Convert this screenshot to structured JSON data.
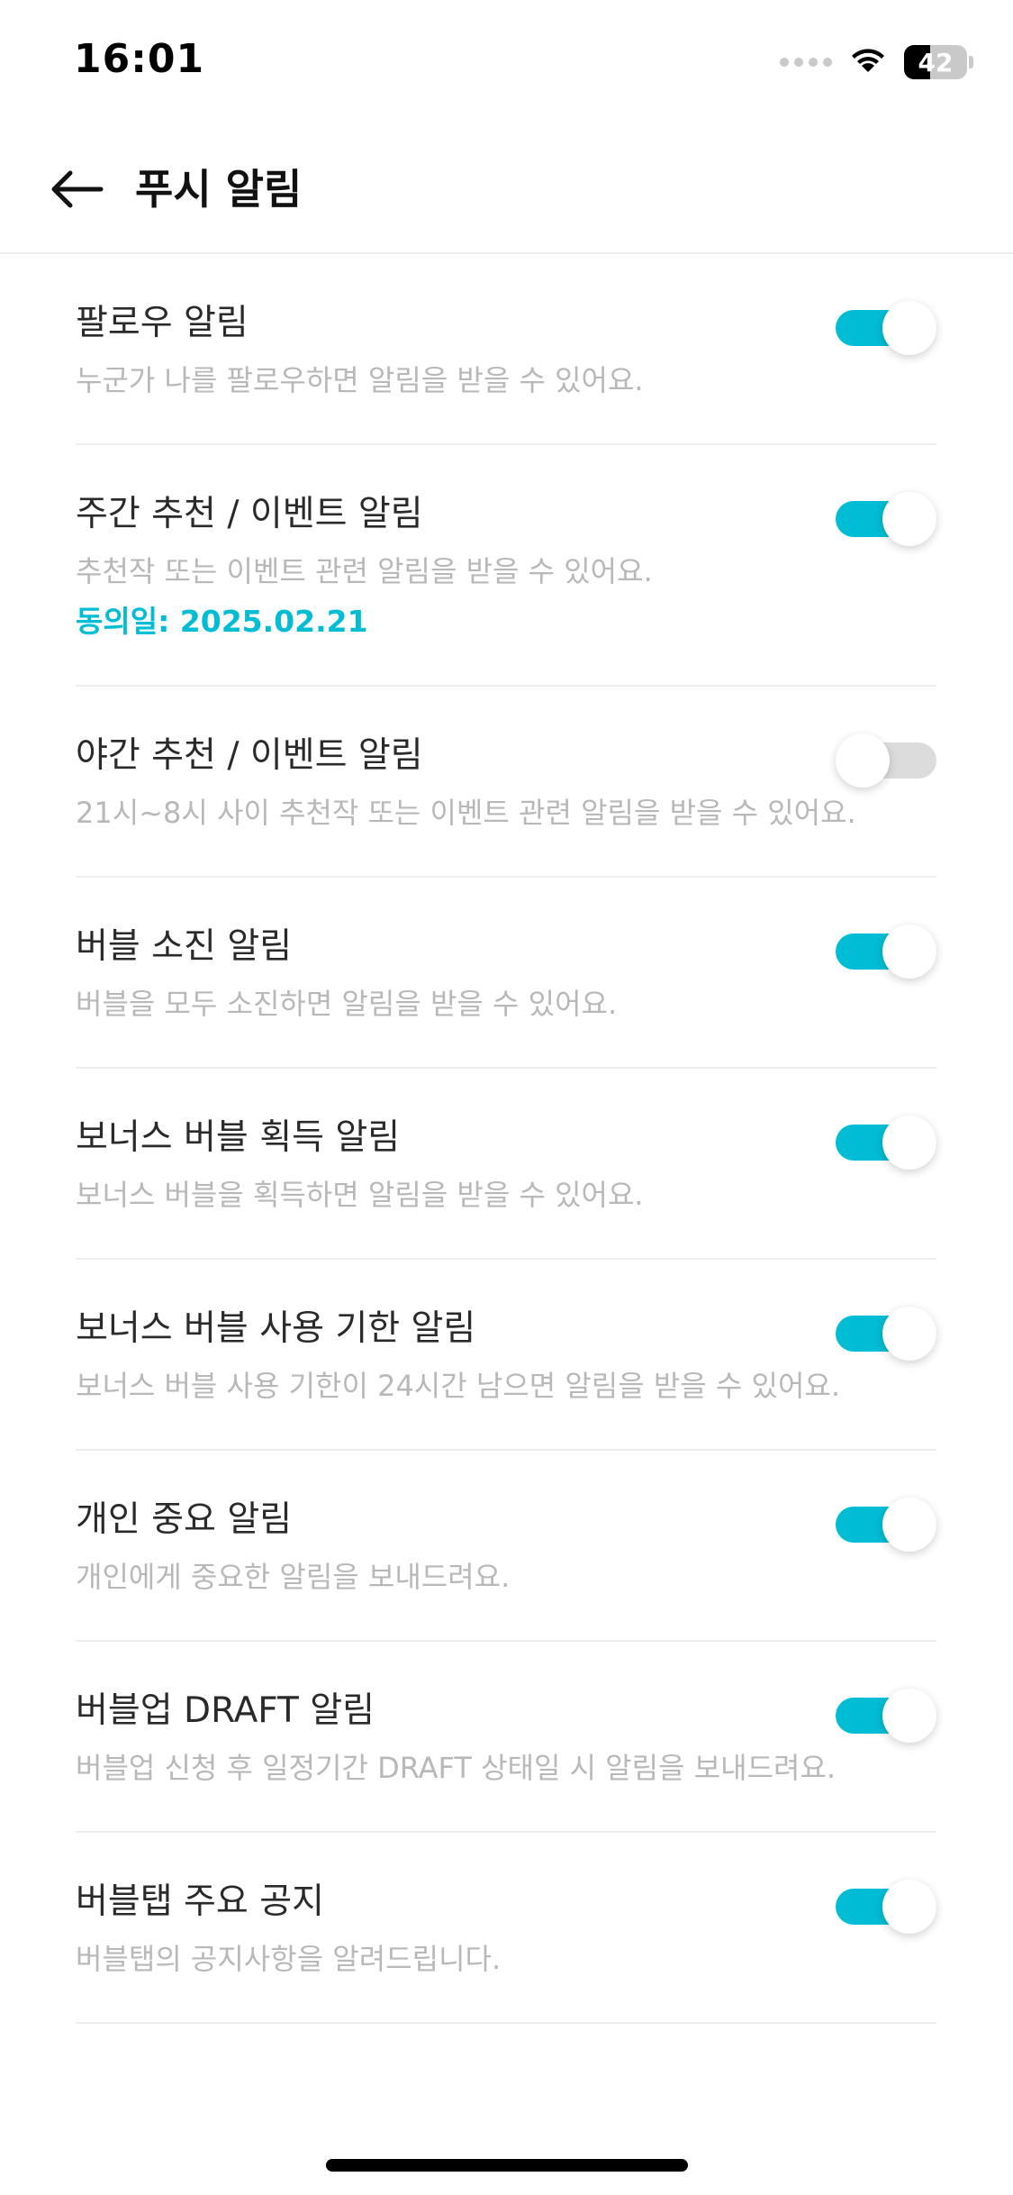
{
  "status_bar": {
    "time": "16:01",
    "battery": "42",
    "battery_level": 0.42
  },
  "header": {
    "title": "푸시 알림"
  },
  "colors": {
    "accent": "#00bcd4",
    "toggle_off": "#dcdcdc",
    "desc_text": "#b8b8b8"
  },
  "settings": [
    {
      "title": "팔로우 알림",
      "description": "누군가 나를 팔로우하면 알림을 받을 수 있어요.",
      "enabled": true
    },
    {
      "title": "주간 추천 / 이벤트 알림",
      "description": "추천작 또는 이벤트 관련 알림을 받을 수 있어요.",
      "agreed": "동의일: 2025.02.21",
      "enabled": true
    },
    {
      "title": "야간 추천 / 이벤트 알림",
      "description": "21시~8시 사이 추천작 또는 이벤트 관련 알림을 받을 수 있어요.",
      "enabled": false
    },
    {
      "title": "버블 소진 알림",
      "description": "버블을 모두 소진하면 알림을 받을 수 있어요.",
      "enabled": true
    },
    {
      "title": "보너스 버블 획득 알림",
      "description": "보너스 버블을 획득하면 알림을 받을 수 있어요.",
      "enabled": true
    },
    {
      "title": "보너스 버블 사용 기한 알림",
      "description": "보너스 버블 사용 기한이 24시간 남으면 알림을 받을 수 있어요.",
      "enabled": true
    },
    {
      "title": "개인 중요 알림",
      "description": "개인에게 중요한 알림을 보내드려요.",
      "enabled": true
    },
    {
      "title": "버블업 DRAFT 알림",
      "description": "버블업 신청 후 일정기간 DRAFT 상태일 시 알림을 보내드려요.",
      "enabled": true
    },
    {
      "title": "버블탭 주요 공지",
      "description": "버블탭의 공지사항을 알려드립니다.",
      "enabled": true
    }
  ]
}
